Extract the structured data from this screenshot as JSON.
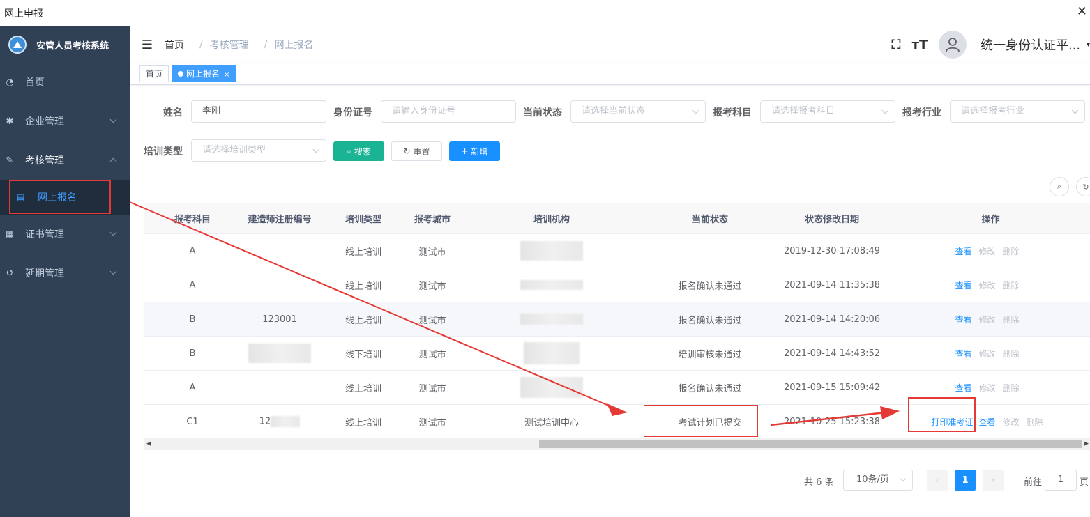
{
  "window": {
    "title": "网上申报",
    "close": "✕"
  },
  "sidebar": {
    "system_name": "安管人员考核系统",
    "items": [
      {
        "label": "首页",
        "icon": "dashboard-icon"
      },
      {
        "label": "企业管理",
        "icon": "gear-icon"
      },
      {
        "label": "考核管理",
        "icon": "edit-icon"
      },
      {
        "label": "证书管理",
        "icon": "certificate-icon"
      },
      {
        "label": "延期管理",
        "icon": "history-icon"
      }
    ],
    "submenu_item": {
      "label": "网上报名",
      "icon": "form-icon"
    }
  },
  "header": {
    "breadcrumb": [
      "首页",
      "考核管理",
      "网上报名"
    ],
    "user_name": "统一身份认证平..."
  },
  "tags": {
    "home": "首页",
    "active": "网上报名",
    "close": "×"
  },
  "form": {
    "name_label": "姓名",
    "name_value": "李刚",
    "id_label": "身份证号",
    "id_placeholder": "请输入身份证号",
    "status_label": "当前状态",
    "status_placeholder": "请选择当前状态",
    "subject_label": "报考科目",
    "subject_placeholder": "请选择报考科目",
    "industry_label": "报考行业",
    "industry_placeholder": "请选择报考行业",
    "training_label": "培训类型",
    "training_placeholder": "请选择培训类型",
    "search_button": "搜索",
    "reset_button": "重置",
    "add_button": "新增"
  },
  "table": {
    "columns": [
      "报考科目",
      "建造师注册编号",
      "培训类型",
      "报考城市",
      "培训机构",
      "当前状态",
      "状态修改日期",
      "操作"
    ],
    "rows": [
      {
        "subject": "A",
        "reg_no": "",
        "training": "线上培训",
        "city": "测试市",
        "org": "",
        "status": "",
        "date": "2019-12-30 17:08:49"
      },
      {
        "subject": "A",
        "reg_no": "",
        "training": "线上培训",
        "city": "测试市",
        "org": "",
        "status": "报名确认未通过",
        "date": "2021-09-14 11:35:38"
      },
      {
        "subject": "B",
        "reg_no": "123001",
        "training": "线上培训",
        "city": "测试市",
        "org": "",
        "status": "报名确认未通过",
        "date": "2021-09-14 14:20:06"
      },
      {
        "subject": "B",
        "reg_no": "",
        "training": "线下培训",
        "city": "测试市",
        "org": "",
        "status": "培训审核未通过",
        "date": "2021-09-14 14:43:52"
      },
      {
        "subject": "A",
        "reg_no": "",
        "training": "线上培训",
        "city": "测试市",
        "org": "",
        "status": "报名确认未通过",
        "date": "2021-09-15 15:09:42"
      },
      {
        "subject": "C1",
        "reg_no": "12",
        "training": "线上培训",
        "city": "测试市",
        "org": "测试培训中心",
        "status": "考试计划已提交",
        "date": "2021-10-25 15:23:38"
      }
    ],
    "actions": {
      "view": "查看",
      "edit": "修改",
      "delete": "删除",
      "print": "打印准考证"
    }
  },
  "pagination": {
    "total": "共 6 条",
    "page_size": "10条/页",
    "current_page": "1",
    "goto_label": "前往",
    "goto_value": "1",
    "page_suffix": "页"
  },
  "colors": {
    "sidebar_bg": "#304156",
    "primary": "#1890ff",
    "search": "#1ab394",
    "annotation": "#e53935"
  }
}
